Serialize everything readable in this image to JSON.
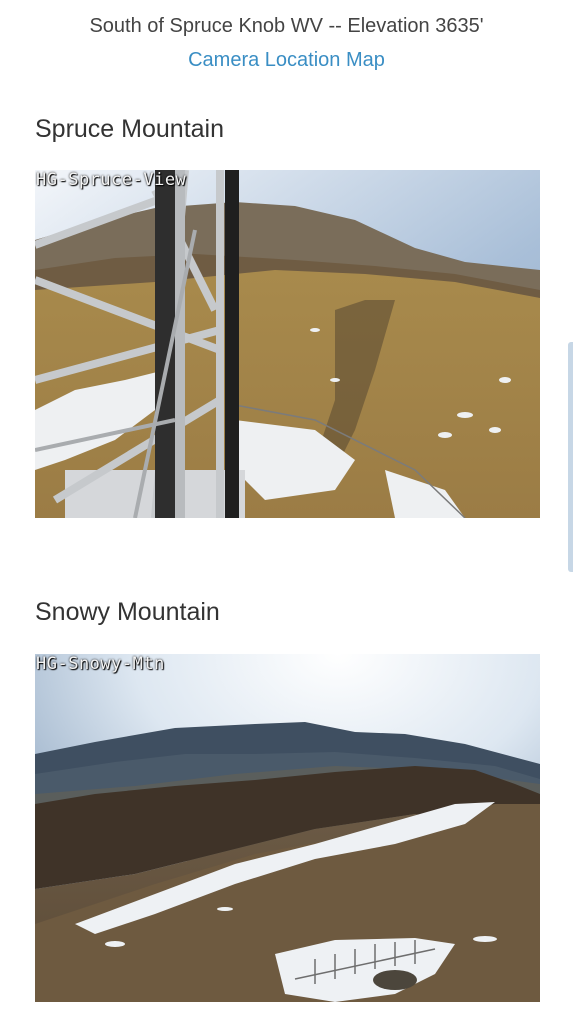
{
  "header": {
    "location_line": "South of Spruce Knob WV -- Elevation 3635'",
    "map_link": "Camera Location Map"
  },
  "cameras": [
    {
      "title": "Spruce Mountain",
      "overlay": "HG-Spruce-View"
    },
    {
      "title": "Snowy Mountain",
      "overlay": "HG-Snowy-Mtn"
    }
  ]
}
